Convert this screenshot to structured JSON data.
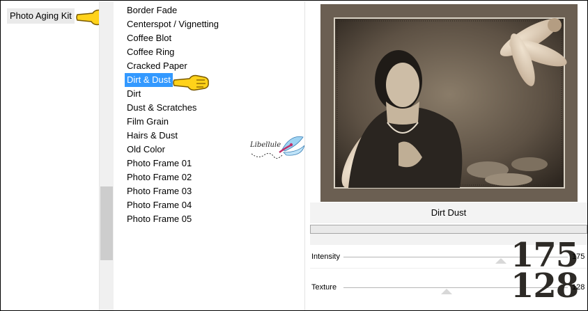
{
  "category_pane": {
    "items": [
      {
        "label": "Photo Aging Kit"
      }
    ]
  },
  "filter_list": {
    "items": [
      {
        "label": "Border Fade"
      },
      {
        "label": "Centerspot / Vignetting"
      },
      {
        "label": "Coffee Blot"
      },
      {
        "label": "Coffee Ring"
      },
      {
        "label": "Cracked Paper"
      },
      {
        "label": "Dirt & Dust",
        "selected": true
      },
      {
        "label": "Dirt"
      },
      {
        "label": "Dust & Scratches"
      },
      {
        "label": "Film Grain"
      },
      {
        "label": "Hairs & Dust"
      },
      {
        "label": "Old Color"
      },
      {
        "label": "Photo Frame 01"
      },
      {
        "label": "Photo Frame 02"
      },
      {
        "label": "Photo Frame 03"
      },
      {
        "label": "Photo Frame 04"
      },
      {
        "label": "Photo Frame 05"
      }
    ]
  },
  "watermark": {
    "text": "Libellule"
  },
  "settings": {
    "title": "Dirt  Dust",
    "params": [
      {
        "label": "Intensity",
        "value": "175",
        "big": "175"
      },
      {
        "label": "Texture",
        "value": "128",
        "big": "128"
      }
    ]
  },
  "colors": {
    "selection": "#3399ff",
    "hand_fill": "#ffd21a",
    "preview_tone": "#5b4f42"
  },
  "icons": {
    "hand": "pointing-hand-icon",
    "watermark": "dragonfly-icon"
  }
}
